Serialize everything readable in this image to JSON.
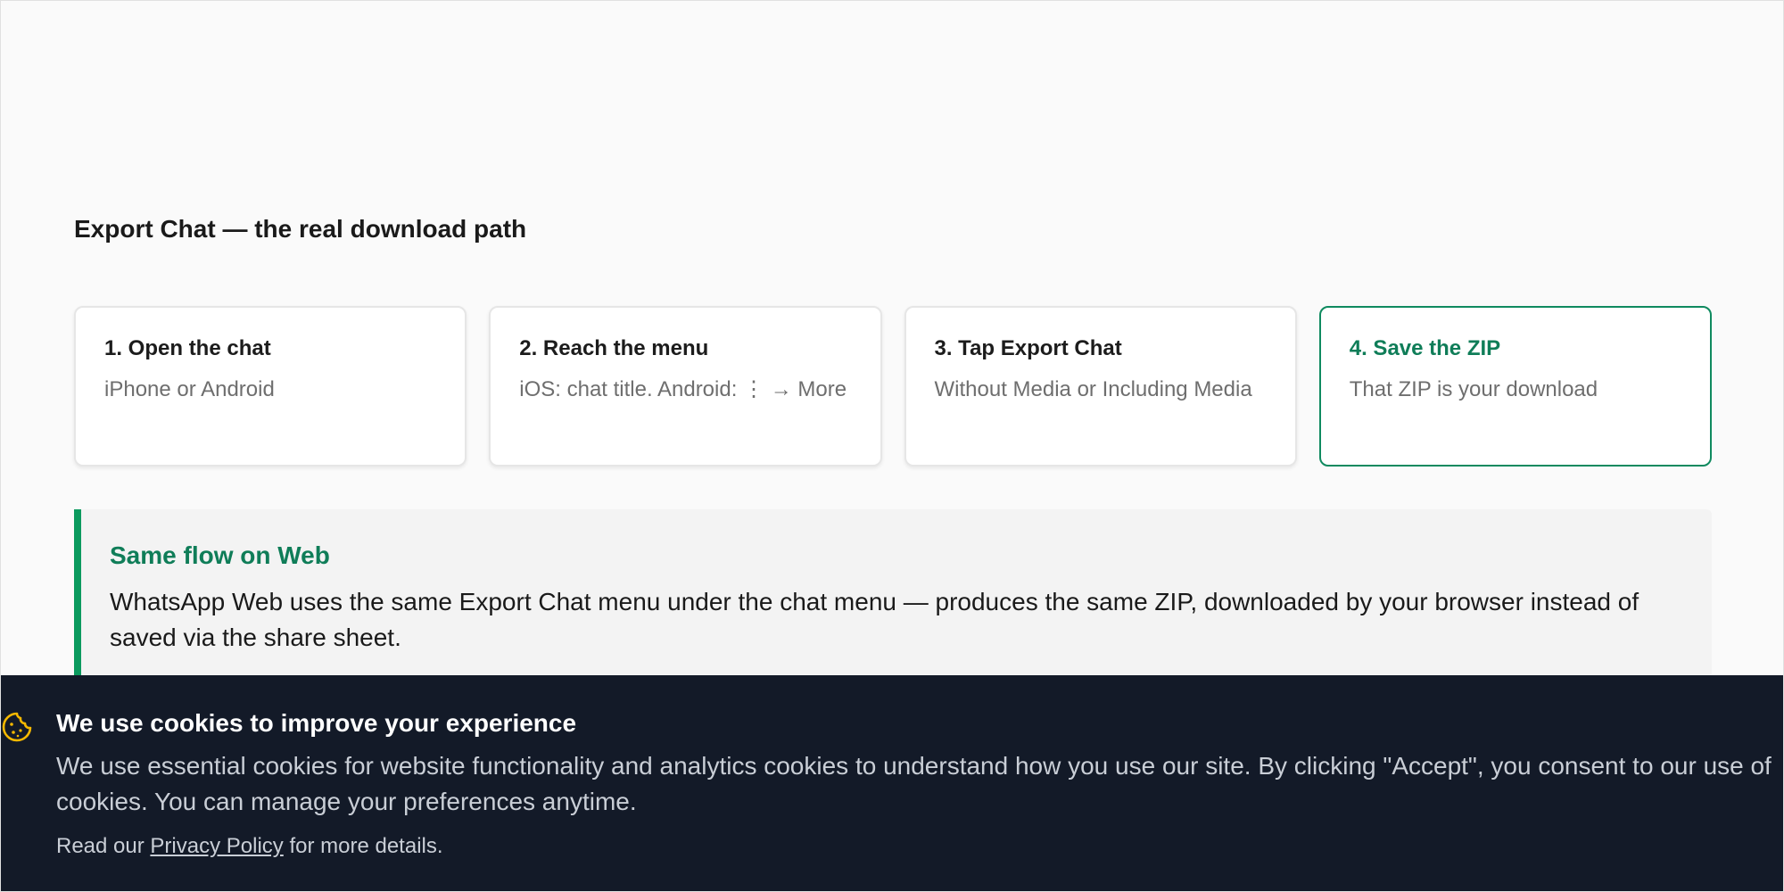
{
  "section": {
    "title": "Export Chat — the real download path"
  },
  "steps": [
    {
      "title": "1. Open the chat",
      "description": "iPhone or Android"
    },
    {
      "title": "2. Reach the menu",
      "description": "iOS: chat title. Android: ⋮ → More"
    },
    {
      "title": "3. Tap Export Chat",
      "description": "Without Media or Including Media"
    },
    {
      "title": "4. Save the ZIP",
      "description": "That ZIP is your download"
    }
  ],
  "note": {
    "title": "Same flow on Web",
    "body": "WhatsApp Web uses the same Export Chat menu under the chat menu — produces the same ZIP, downloaded by your browser instead of saved via the share sheet."
  },
  "cookie_banner": {
    "icon": "cookie-icon",
    "title": "We use cookies to improve your experience",
    "text": "We use essential cookies for website functionality and analytics cookies to understand how you use our site. By clicking \"Accept\", you consent to our use of cookies. You can manage your preferences anytime.",
    "footer_prefix": "Read our",
    "privacy_link": "Privacy Policy",
    "footer_suffix": "for more details."
  },
  "colors": {
    "accent_green": "#0f7d58",
    "note_border": "#0b9a5e",
    "banner_bg": "#131a28",
    "cookie_icon": "#f5b800"
  }
}
